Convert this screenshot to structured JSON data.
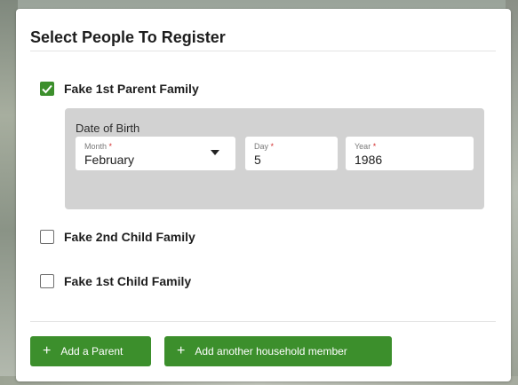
{
  "dialog": {
    "title": "Select People To Register"
  },
  "people": [
    {
      "name": "Fake 1st Parent Family",
      "checked": true
    },
    {
      "name": "Fake 2nd Child Family",
      "checked": false
    },
    {
      "name": "Fake 1st Child Family",
      "checked": false
    }
  ],
  "dob": {
    "label": "Date of Birth",
    "month": {
      "label": "Month",
      "value": "February"
    },
    "day": {
      "label": "Day",
      "value": "5"
    },
    "year": {
      "label": "Year",
      "value": "1986"
    },
    "required_marker": "*"
  },
  "buttons": {
    "plus_icon": "+",
    "add_parent": "Add a Parent",
    "add_member": "Add another household member"
  },
  "colors": {
    "accent": "#3c8f2c",
    "panel": "#d2d2d2",
    "required": "#d32f2f"
  }
}
